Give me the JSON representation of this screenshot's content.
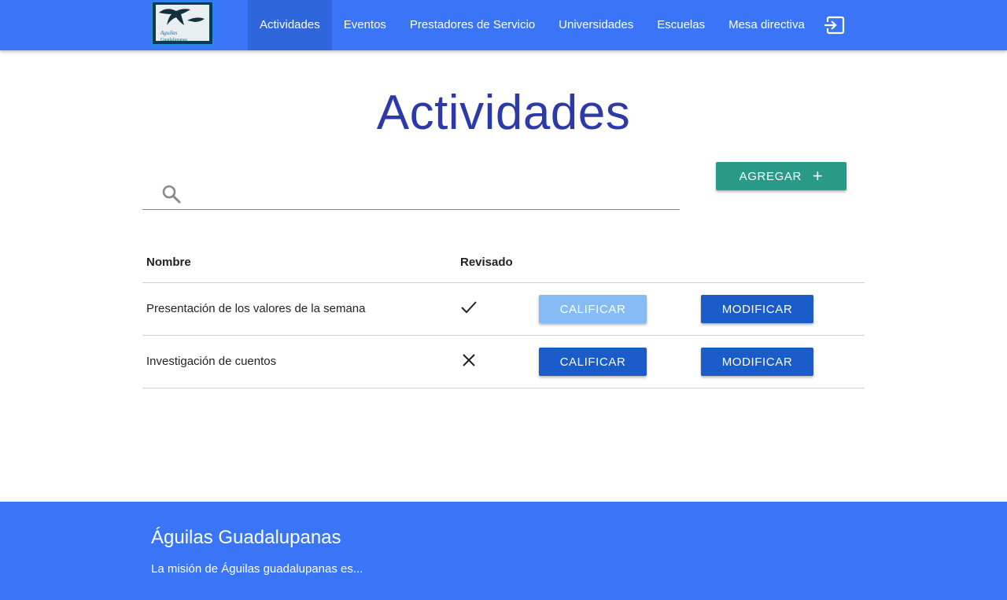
{
  "colors": {
    "primary": "#3a75f8",
    "title": "#2c3aa8",
    "add_button": "#2a9a88",
    "action_button": "#1a5cc9",
    "action_button_disabled": "#85bcf5"
  },
  "nav": {
    "logo_icon": "aguilas-guadalupanas-logo",
    "items": [
      {
        "label": "Actividades",
        "active": true
      },
      {
        "label": "Eventos"
      },
      {
        "label": "Prestadores de Servicio"
      },
      {
        "label": "Universidades"
      },
      {
        "label": "Escuelas"
      },
      {
        "label": "Mesa directiva"
      }
    ],
    "logout_icon": "logout-icon"
  },
  "page": {
    "title": "Actividades"
  },
  "search": {
    "value": "",
    "icon": "search-icon"
  },
  "add_button": {
    "label": "AGREGAR",
    "icon": "+"
  },
  "table": {
    "headers": [
      "Nombre",
      "Revisado"
    ],
    "rows": [
      {
        "name": "Presentación de los valores de la semana",
        "reviewed": true,
        "status_icon": "check-icon",
        "grade_label": "CALIFICAR",
        "grade_disabled": true,
        "edit_label": "MODIFICAR"
      },
      {
        "name": "Investigación de cuentos",
        "reviewed": false,
        "status_icon": "close-icon",
        "grade_label": "CALIFICAR",
        "grade_disabled": false,
        "edit_label": "MODIFICAR"
      }
    ]
  },
  "footer": {
    "title": "Águilas Guadalupanas",
    "text": "La misión de Águilas guadalupanas es..."
  }
}
